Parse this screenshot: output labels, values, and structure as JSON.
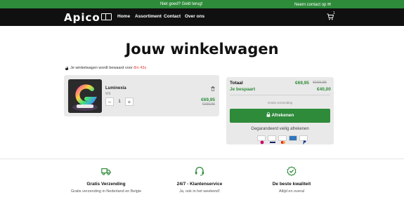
{
  "topbar": {
    "promo": "Niet goed? Geld terug!",
    "contact": "Neem contact op ✉"
  },
  "nav": {
    "logo": "Apico",
    "items": [
      "Home",
      "Assortiment",
      "Contact",
      "Over ons"
    ],
    "cart_count": "1"
  },
  "page": {
    "title": "Jouw winkelwagen",
    "reserved_text": "Je winkelwagen wordt bewaard voor",
    "reserved_timer": "8m 43s"
  },
  "cart_item": {
    "name": "Luminexia",
    "variant": "Wit",
    "quantity": "1",
    "minus": "−",
    "plus": "+",
    "price": "€69,95",
    "old_price": "€169,95"
  },
  "summary": {
    "total_label": "Totaal",
    "total_value": "€69,95",
    "total_old": "€169,95",
    "savings_label": "Je bespaart",
    "savings_value": "€40,00",
    "shipping_note": "Gratis verzending",
    "checkout_label": "Afrekenen",
    "secure_text": "Gegarandeerd veilig afrekenen",
    "payment_icons": [
      "ideal-icon",
      "visa-icon",
      "mastercard-icon",
      "amex-icon",
      "paypal-icon"
    ]
  },
  "features": [
    {
      "icon": "truck-icon",
      "title": "Gratis Verzending",
      "subtitle": "Gratis verzending in Nederland en Belgie"
    },
    {
      "icon": "headset-icon",
      "title": "24/7 - Klantenservice",
      "subtitle": "Ja, ook in het weekend!"
    },
    {
      "icon": "quality-check-icon",
      "title": "De beste kwaliteit",
      "subtitle": "Altijd en overal"
    }
  ],
  "colors": {
    "brand_green": "#2e8b3a",
    "nav_bg": "#101010",
    "timer_red": "#e03b3b",
    "card_bg": "#e9e9e9"
  }
}
